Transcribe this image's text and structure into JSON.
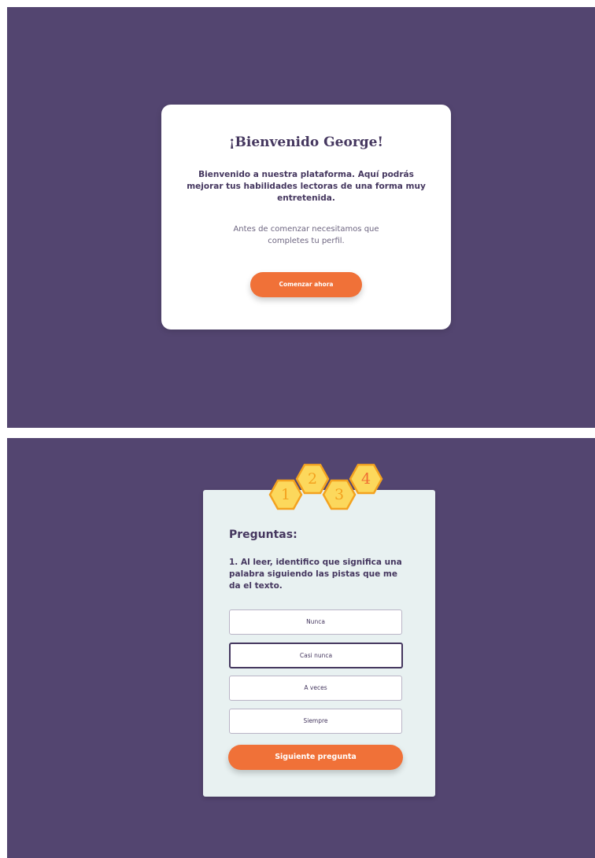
{
  "colors": {
    "background": "#534570",
    "accent": "#f07138",
    "text_dark": "#45375f",
    "hex_fill": "#fcd85c",
    "hex_border": "#f3a21f"
  },
  "welcome": {
    "title": "¡Bienvenido George!",
    "text": "Bienvenido a nuestra plataforma. Aquí podrás mejorar tus habilidades lectoras de una forma muy entretenida.",
    "subtext": "Antes de comenzar necesitamos que completes tu perfil.",
    "button_label": "Comenzar ahora"
  },
  "steps": [
    {
      "label": "1",
      "icon": "hexagon-icon"
    },
    {
      "label": "2",
      "icon": "hexagon-icon"
    },
    {
      "label": "3",
      "icon": "hexagon-icon"
    },
    {
      "label": "4",
      "icon": "hexagon-icon"
    }
  ],
  "question": {
    "heading": "Preguntas:",
    "text": "1. Al leer, identifico que significa una palabra siguiendo las pistas que me da el texto.",
    "options": [
      {
        "label": "Nunca",
        "selected": false
      },
      {
        "label": "Casi nunca",
        "selected": true
      },
      {
        "label": "A veces",
        "selected": false
      },
      {
        "label": "Siempre",
        "selected": false
      }
    ],
    "next_label": "Siguiente pregunta"
  }
}
